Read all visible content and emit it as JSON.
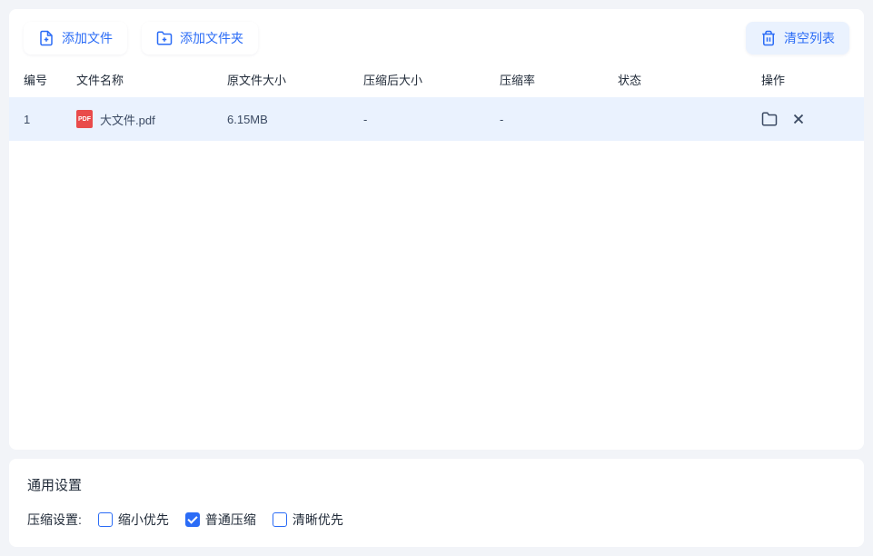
{
  "toolbar": {
    "add_file": "添加文件",
    "add_folder": "添加文件夹",
    "clear_list": "清空列表"
  },
  "headers": {
    "index": "编号",
    "name": "文件名称",
    "orig_size": "原文件大小",
    "after_size": "压缩后大小",
    "ratio": "压缩率",
    "status": "状态",
    "action": "操作"
  },
  "rows": [
    {
      "index": "1",
      "icon": "PDF",
      "name": "大文件.pdf",
      "orig_size": "6.15MB",
      "after_size": "-",
      "ratio": "-",
      "status": ""
    }
  ],
  "settings": {
    "title": "通用设置",
    "label": "压缩设置:",
    "options": [
      {
        "label": "缩小优先",
        "checked": false
      },
      {
        "label": "普通压缩",
        "checked": true
      },
      {
        "label": "清晰优先",
        "checked": false
      }
    ]
  }
}
